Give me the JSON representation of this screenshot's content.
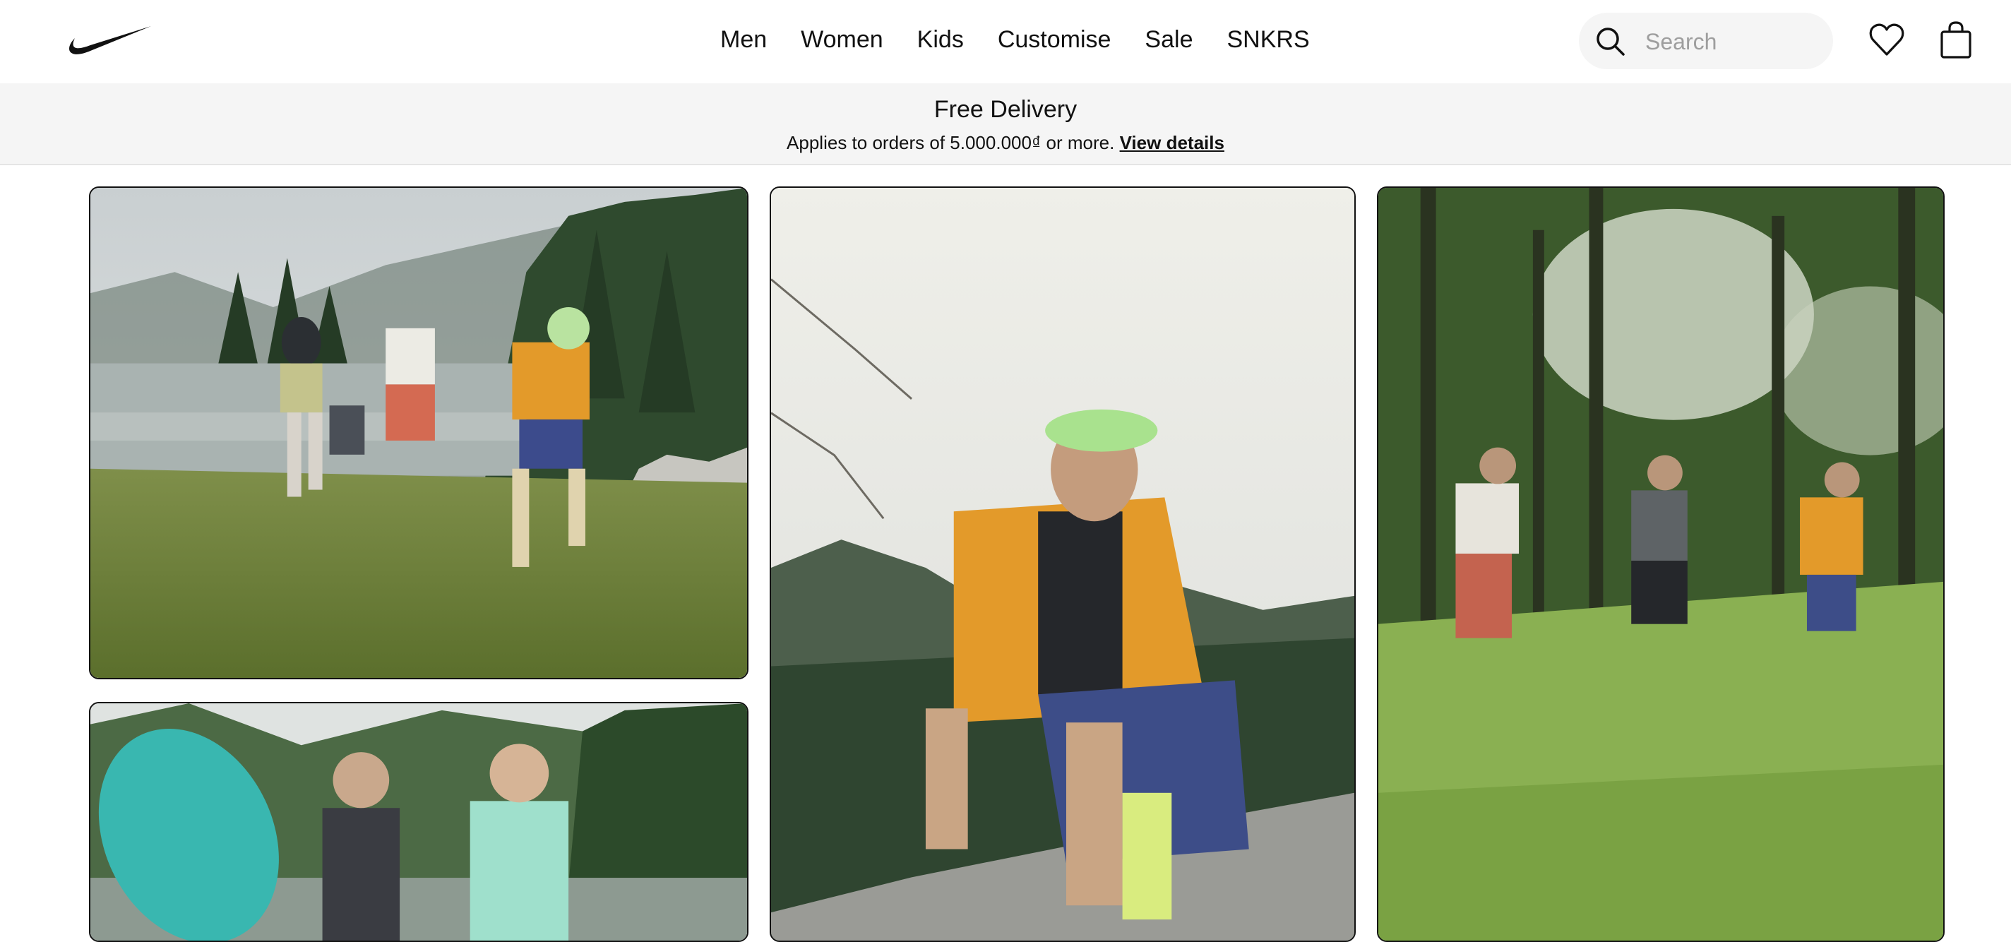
{
  "header": {
    "logo": "nike-swoosh-logo",
    "nav": [
      "Men",
      "Women",
      "Kids",
      "Customise",
      "Sale",
      "SNKRS"
    ],
    "search": {
      "placeholder": "Search",
      "value": ""
    },
    "icons": [
      "search-icon",
      "heart-icon",
      "shopping-bag-icon"
    ]
  },
  "promo": {
    "title": "Free Delivery",
    "text": "Applies to orders of 5.000.000₫ or more.",
    "link": "View details"
  },
  "colors": {
    "text": "#111111",
    "promo_background": "#f5f5f5",
    "search_background": "#f5f5f5",
    "placeholder": "#9e9e9e"
  }
}
